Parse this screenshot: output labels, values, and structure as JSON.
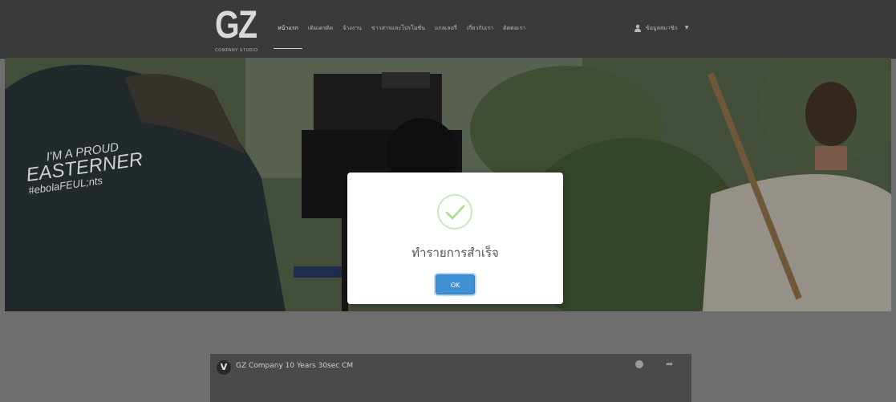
{
  "logo": {
    "mark": "GZ",
    "subtitle": "COMPANY STUDIO"
  },
  "nav": {
    "items": [
      {
        "label": "หน้าแรก",
        "active": true
      },
      {
        "label": "เติมเครดิต",
        "active": false
      },
      {
        "label": "จ้างงาน",
        "active": false
      },
      {
        "label": "ข่าวสารและโปรโมชั่น",
        "active": false
      },
      {
        "label": "แกลเลอรี่",
        "active": false
      },
      {
        "label": "เกี่ยวกับเรา",
        "active": false
      },
      {
        "label": "ติดต่อเรา",
        "active": false
      }
    ],
    "member": {
      "label": "ข้อมูลสมาชิก",
      "icon": "user-icon",
      "caret_icon": "caret-down-icon"
    }
  },
  "hero": {
    "shirt_text": [
      "I'M A PROUD",
      "EASTERNER",
      "#ebolaFEUL;nts"
    ]
  },
  "video": {
    "title": "GZ Company 10 Years 30sec CM",
    "icon": "vimeo-logo-icon"
  },
  "modal": {
    "icon": "success-check-icon",
    "title": "ทำรายการสำเร็จ",
    "ok_label": "OK"
  },
  "colors": {
    "success": "#a5dc86",
    "button": "#3e8fd4",
    "navbar": "#3a3a3a"
  }
}
